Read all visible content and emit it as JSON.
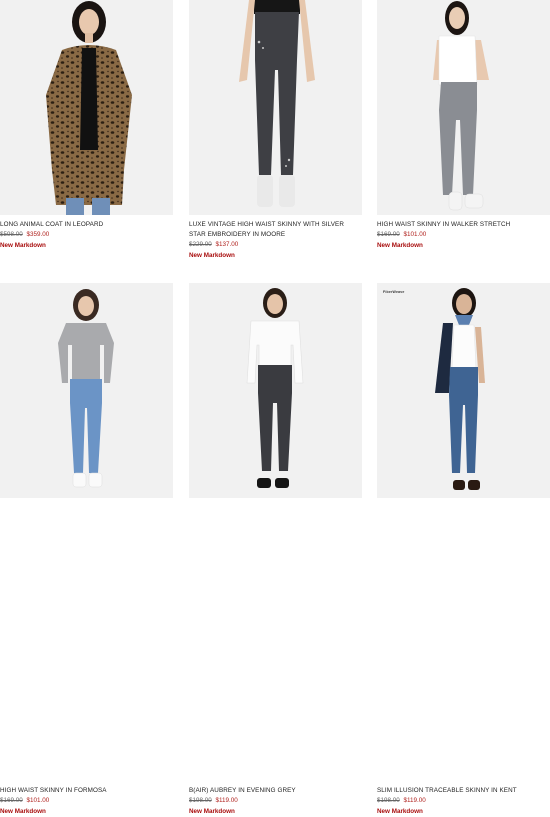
{
  "products": [
    {
      "name": "LONG ANIMAL COAT IN LEOPARD",
      "old_price": "$598.00",
      "new_price": "$359.00",
      "badge": "New Markdown"
    },
    {
      "name": "LUXE VINTAGE HIGH WAIST SKINNY WITH SILVER STAR EMBROIDERY IN MOORE",
      "old_price": "$229.00",
      "new_price": "$137.00",
      "badge": "New Markdown"
    },
    {
      "name": "HIGH WAIST SKINNY IN WALKER STRETCH",
      "old_price": "$169.00",
      "new_price": "$101.00",
      "badge": "New Markdown"
    },
    {
      "name": "HIGH WAIST SKINNY IN FORMOSA",
      "old_price": "$169.00",
      "new_price": "$101.00",
      "badge": "New Markdown"
    },
    {
      "name": "B(AIR) AUBREY IN EVENING GREY",
      "old_price": "$198.00",
      "new_price": "$119.00",
      "badge": "New Markdown"
    },
    {
      "name": "SLIM ILLUSION TRACEABLE SKINNY IN KENT",
      "old_price": "$198.00",
      "new_price": "$119.00",
      "badge": "New Markdown",
      "image_tag": "FiberWeave"
    }
  ]
}
